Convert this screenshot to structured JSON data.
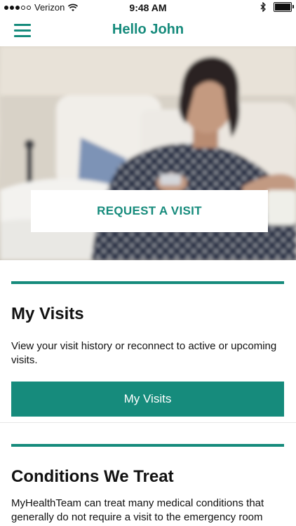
{
  "status_bar": {
    "carrier": "Verizon",
    "time": "9:48 AM",
    "signal_full": 3,
    "signal_total": 5,
    "battery_level": 1.0,
    "icons": [
      "signal-dots-icon",
      "wifi-icon",
      "bluetooth-icon",
      "battery-icon"
    ]
  },
  "nav": {
    "title": "Hello John",
    "menu_icon": "hamburger-menu-icon"
  },
  "hero": {
    "button_label": "REQUEST A VISIT"
  },
  "visits": {
    "title": "My Visits",
    "description": "View your visit history or reconnect to active or upcoming visits.",
    "button_label": "My Visits"
  },
  "conditions": {
    "title": "Conditions We Treat",
    "description": "MyHealthTeam can treat many medical conditions that generally do not require a visit to the emergency room"
  },
  "colors": {
    "accent": "#168b7c",
    "background": "#ffffff",
    "text": "#111111"
  }
}
